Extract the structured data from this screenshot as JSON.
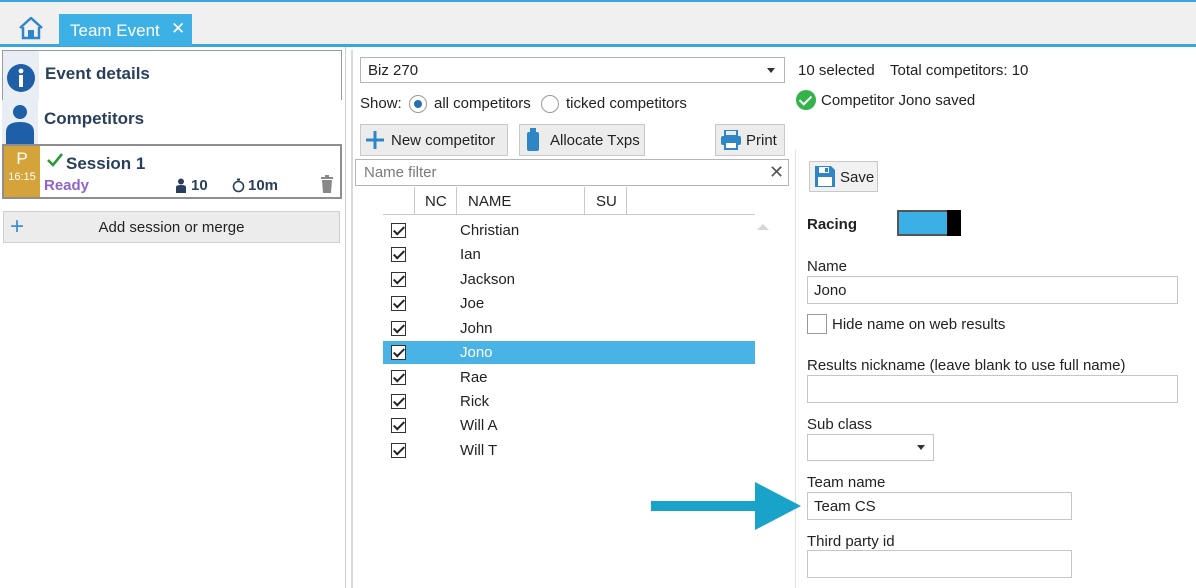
{
  "tabs": {
    "active_tab": "Team Event",
    "close_glyph": "✕"
  },
  "sidebar": {
    "event_details": "Event details",
    "competitors": "Competitors",
    "session": {
      "badge_letter": "P",
      "badge_time": "16:15",
      "title": "Session 1",
      "status": "Ready",
      "competitor_count": "10",
      "duration": "10m"
    },
    "add_session": "Add session or merge"
  },
  "center": {
    "class_select_value": "Biz 270",
    "show_label": "Show:",
    "show_options": [
      "all competitors",
      "ticked competitors"
    ],
    "show_selected_index": 0,
    "buttons": {
      "new_competitor": "New competitor",
      "allocate_txps": "Allocate Txps",
      "print": "Print"
    },
    "name_filter_placeholder": "Name filter",
    "table": {
      "columns": [
        "NC",
        "NAME",
        "SU"
      ],
      "rows": [
        {
          "checked": true,
          "name": "Christian"
        },
        {
          "checked": true,
          "name": "Ian"
        },
        {
          "checked": true,
          "name": "Jackson"
        },
        {
          "checked": true,
          "name": "Joe"
        },
        {
          "checked": true,
          "name": "John"
        },
        {
          "checked": true,
          "name": "Jono",
          "selected": true
        },
        {
          "checked": true,
          "name": "Rae"
        },
        {
          "checked": true,
          "name": "Rick"
        },
        {
          "checked": true,
          "name": "Will A"
        },
        {
          "checked": true,
          "name": "Will T"
        }
      ]
    }
  },
  "right": {
    "selected_info": "10 selected",
    "total_info": "Total competitors: 10",
    "saved_message": "Competitor Jono saved",
    "save_button": "Save",
    "racing_label": "Racing",
    "racing_on": true,
    "fields": {
      "name_label": "Name",
      "name_value": "Jono",
      "hide_name_label": "Hide name on web results",
      "nickname_label": "Results nickname (leave blank to use full name)",
      "nickname_value": "",
      "sub_class_label": "Sub class",
      "team_name_label": "Team name",
      "team_name_value": "Team CS",
      "third_party_label": "Third party id",
      "third_party_value": ""
    }
  },
  "colors": {
    "accent": "#3db0e6",
    "session_badge": "#d4a43a",
    "status_ready": "#8f65c7",
    "annotation_arrow": "#1aa3c8",
    "success": "#34b34a"
  }
}
